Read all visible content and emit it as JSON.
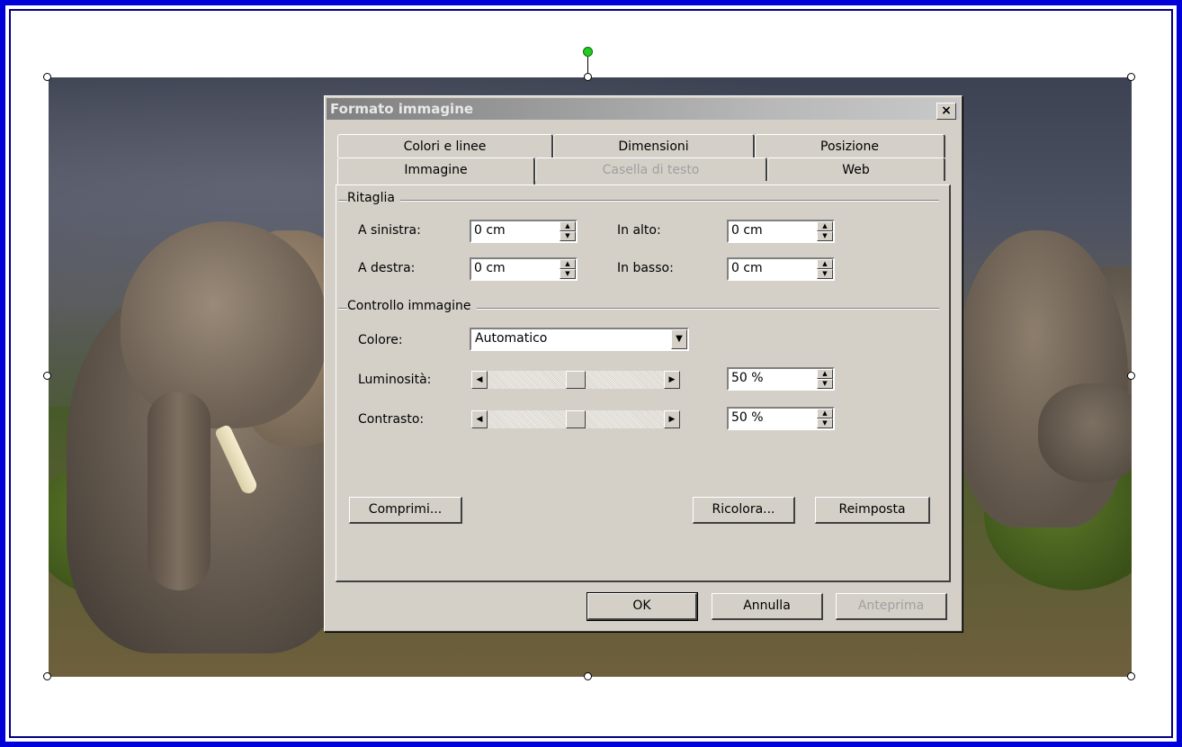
{
  "dialog": {
    "title": "Formato immagine",
    "close_glyph": "×",
    "tabs_back": [
      "Colori e linee",
      "Dimensioni",
      "Posizione"
    ],
    "tabs_front": [
      "Immagine",
      "Casella di testo",
      "Web"
    ],
    "active_tab": "Immagine",
    "disabled_tab": "Casella di testo"
  },
  "crop": {
    "group_label": "Ritaglia",
    "left_label": "A sinistra:",
    "left_value": "0 cm",
    "right_label": "A destra:",
    "right_value": "0 cm",
    "top_label": "In alto:",
    "top_value": "0 cm",
    "bottom_label": "In basso:",
    "bottom_value": "0 cm"
  },
  "image_control": {
    "group_label": "Controllo immagine",
    "color_label": "Colore:",
    "color_value": "Automatico",
    "brightness_label": "Luminosità:",
    "brightness_value": "50 %",
    "brightness_level": 0.5,
    "contrast_label": "Contrasto:",
    "contrast_value": "50 %",
    "contrast_level": 0.5
  },
  "buttons": {
    "compress": "Comprimi...",
    "recolor": "Ricolora...",
    "reset": "Reimposta",
    "ok": "OK",
    "cancel": "Annulla",
    "preview": "Anteprima"
  },
  "icons": {
    "spin_up": "▲",
    "spin_down": "▼",
    "combo_arrow": "▼",
    "scroll_left": "◀",
    "scroll_right": "▶"
  }
}
